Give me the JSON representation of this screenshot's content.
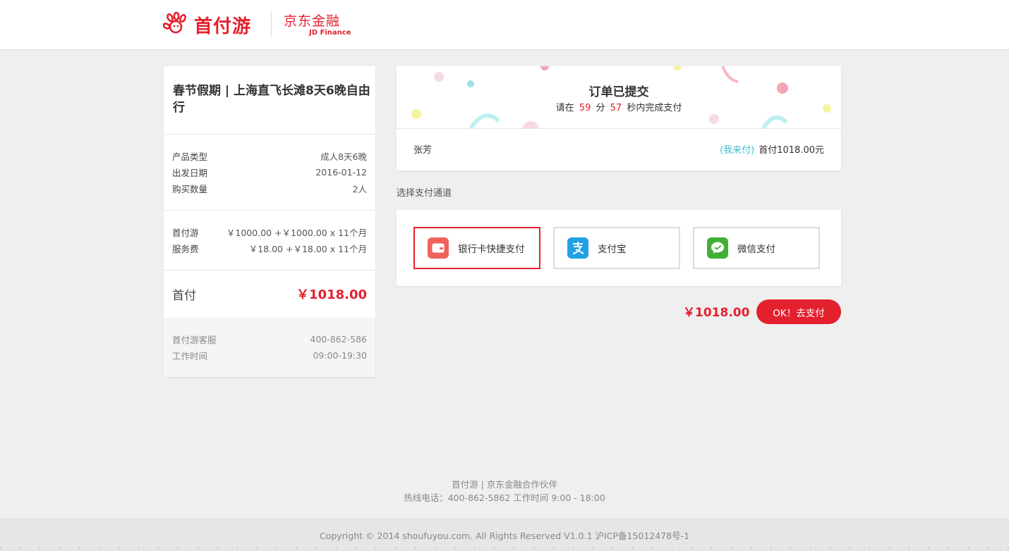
{
  "header": {
    "brand_name": "首付游",
    "partner_name_cn": "京东金融",
    "partner_name_en": "JD Finance",
    "brand_logo_icon": "hand-logo-icon"
  },
  "product": {
    "title": "春节假期 | 上海直飞长滩8天6晚自由行",
    "details": [
      {
        "label": "产品类型",
        "value": "成人8天6晚"
      },
      {
        "label": "出发日期",
        "value": "2016-01-12"
      },
      {
        "label": "购买数量",
        "value": "2人"
      }
    ],
    "fees": [
      {
        "label": "首付游",
        "value": "￥1000.00 +￥1000.00 x 11个月"
      },
      {
        "label": "服务费",
        "value": "￥18.00 +￥18.00 x 11个月"
      }
    ],
    "total_label": "首付",
    "total_value": "￥1018.00",
    "service": [
      {
        "label": "首付游客服",
        "value": "400-862-586"
      },
      {
        "label": "工作时间",
        "value": "09:00-19:30"
      }
    ]
  },
  "order": {
    "title": "订单已提交",
    "countdown_prefix": "请在",
    "minutes": "59",
    "minutes_unit": "分",
    "seconds": "57",
    "countdown_suffix": "秒内完成支付",
    "payer_name": "张芳",
    "payer_tag": "(我来付)",
    "payer_amount": "首付1018.00元"
  },
  "payment": {
    "section_label": "选择支付通道",
    "options": [
      {
        "label": "银行卡快捷支付",
        "icon": "bank-card-icon",
        "color": "#f0615c",
        "selected": true
      },
      {
        "label": "支付宝",
        "icon": "alipay-icon",
        "color": "#1fa1e3",
        "selected": false
      },
      {
        "label": "微信支付",
        "icon": "wechat-pay-icon",
        "color": "#41b035",
        "selected": false
      }
    ],
    "amount": "￥1018.00",
    "button_label": "OK！去支付"
  },
  "footer": {
    "partner_line": "首付游 | 京东金融合作伙伴",
    "hotline": "热线电话：400-862-5862 工作时间 9:00 - 18:00",
    "copyright": "Copyright © 2014 shoufuyou.com. All Rights Reserved V1.0.1 沪ICP备15012478号-1"
  },
  "colors": {
    "accent": "#e4202e",
    "teal": "#3ebfcf",
    "background": "#efefef"
  }
}
